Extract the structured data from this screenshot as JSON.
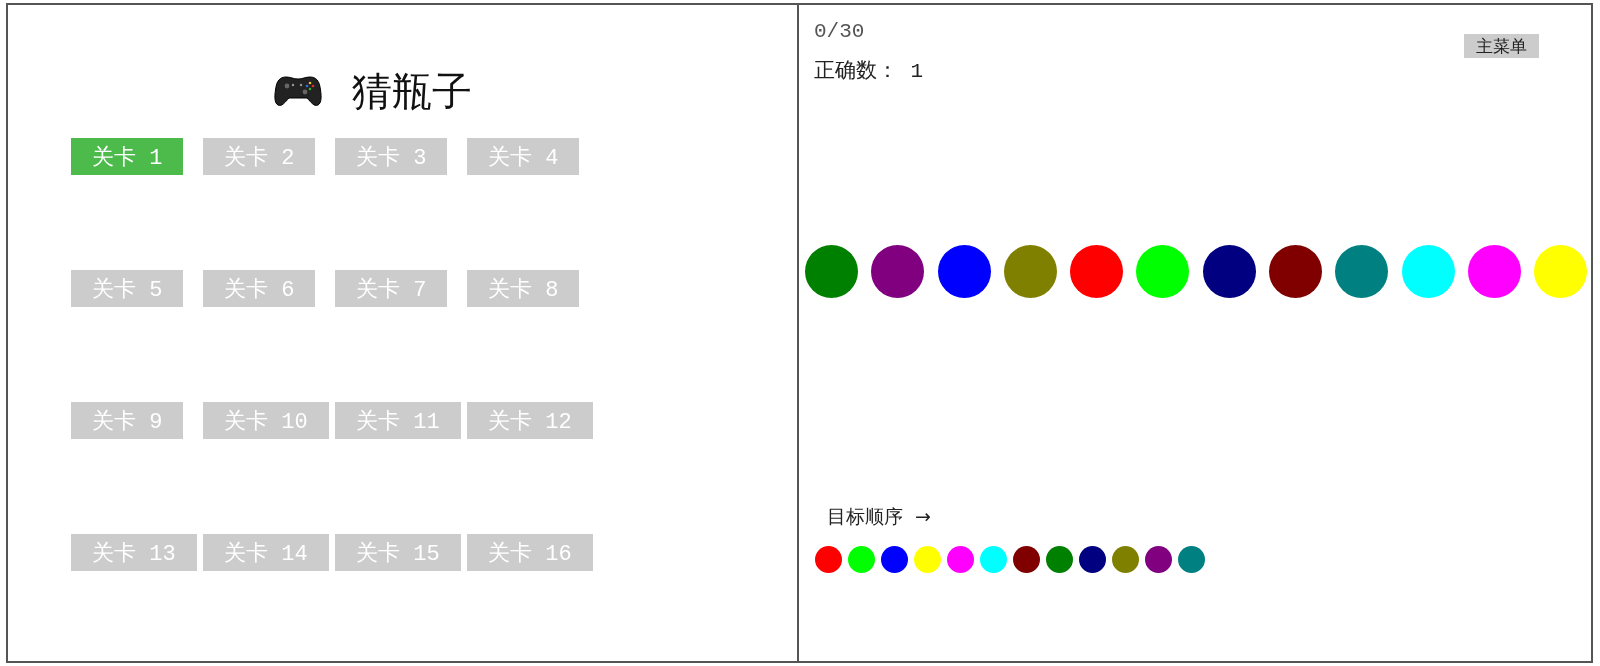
{
  "game": {
    "title": "猜瓶子"
  },
  "levels": [
    {
      "label": "关卡 1",
      "selected": true
    },
    {
      "label": "关卡 2",
      "selected": false
    },
    {
      "label": "关卡 3",
      "selected": false
    },
    {
      "label": "关卡 4",
      "selected": false
    },
    {
      "label": "关卡 5",
      "selected": false
    },
    {
      "label": "关卡 6",
      "selected": false
    },
    {
      "label": "关卡 7",
      "selected": false
    },
    {
      "label": "关卡 8",
      "selected": false
    },
    {
      "label": "关卡 9",
      "selected": false
    },
    {
      "label": "关卡 10",
      "selected": false
    },
    {
      "label": "关卡 11",
      "selected": false
    },
    {
      "label": "关卡 12",
      "selected": false
    },
    {
      "label": "关卡 13",
      "selected": false
    },
    {
      "label": "关卡 14",
      "selected": false
    },
    {
      "label": "关卡 15",
      "selected": false
    },
    {
      "label": "关卡 16",
      "selected": false
    }
  ],
  "status": {
    "progress": "0/30",
    "correct": "正确数： 1"
  },
  "main_menu_button": "主菜单",
  "bottles": [
    {
      "color": "#008000"
    },
    {
      "color": "#800080"
    },
    {
      "color": "#0000ff"
    },
    {
      "color": "#808000"
    },
    {
      "color": "#ff0000"
    },
    {
      "color": "#00ff00"
    },
    {
      "color": "#000080"
    },
    {
      "color": "#800000"
    },
    {
      "color": "#008080"
    },
    {
      "color": "#00ffff"
    },
    {
      "color": "#ff00ff"
    },
    {
      "color": "#ffff00"
    }
  ],
  "target": {
    "label": "目标顺序 →",
    "bottles": [
      {
        "color": "#ff0000"
      },
      {
        "color": "#00ff00"
      },
      {
        "color": "#0000ff"
      },
      {
        "color": "#ffff00"
      },
      {
        "color": "#ff00ff"
      },
      {
        "color": "#00ffff"
      },
      {
        "color": "#800000"
      },
      {
        "color": "#008000"
      },
      {
        "color": "#000080"
      },
      {
        "color": "#808000"
      },
      {
        "color": "#800080"
      },
      {
        "color": "#008080"
      }
    ]
  }
}
